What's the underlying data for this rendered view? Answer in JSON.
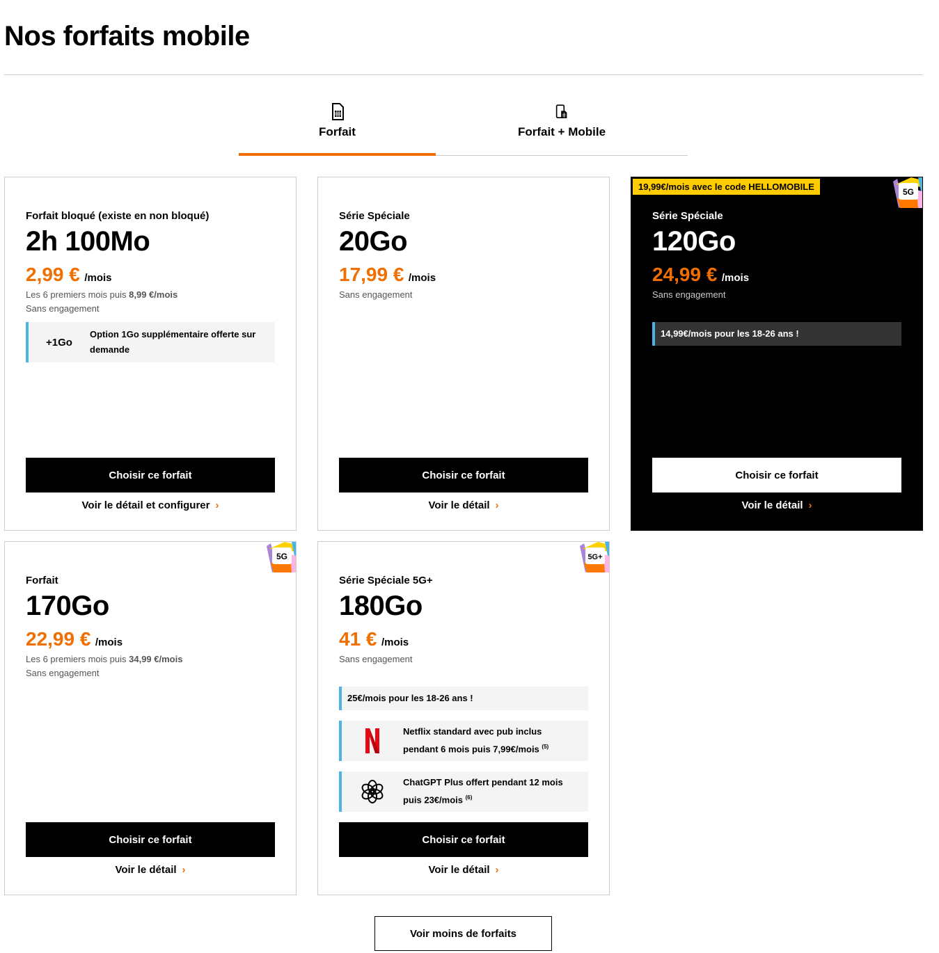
{
  "page": {
    "title": "Nos forfaits mobile"
  },
  "tabs": [
    {
      "label": "Forfait",
      "icon": "sim-card-icon",
      "active": true
    },
    {
      "label": "Forfait + Mobile",
      "icon": "phone-sim-icon",
      "active": false
    }
  ],
  "colors": {
    "accent": "#f16e00",
    "promo_border": "#4bb4e6",
    "banner": "#ffcc00"
  },
  "cards": [
    {
      "category": "Forfait bloqué (existe en non bloqué)",
      "name": "2h 100Mo",
      "price": "2,99 €",
      "per": "/mois",
      "subnote_prefix": "Les 6 premiers mois puis ",
      "subnote_value": "8,99 €/mois",
      "engagement": "Sans engagement",
      "promo_lead": "+1Go",
      "promo_text": "Option 1Go supplémentaire offerte sur demande",
      "cta": "Choisir ce forfait",
      "detail": "Voir le détail et configurer"
    },
    {
      "category": "Série Spéciale",
      "name": "20Go",
      "price": "17,99 €",
      "per": "/mois",
      "engagement": "Sans engagement",
      "cta": "Choisir ce forfait",
      "detail": "Voir le détail"
    },
    {
      "banner": "19,99€/mois avec le code HELLOMOBILE",
      "badge": "5G",
      "category": "Série Spéciale",
      "name": "120Go",
      "price": "24,99 €",
      "per": "/mois",
      "engagement": "Sans engagement",
      "promo_text": "14,99€/mois pour les 18-26 ans !",
      "cta": "Choisir ce forfait",
      "detail": "Voir le détail"
    },
    {
      "badge": "5G",
      "category": "Forfait",
      "name": "170Go",
      "price": "22,99 €",
      "per": "/mois",
      "subnote_prefix": "Les 6 premiers mois puis ",
      "subnote_value": "34,99 €/mois",
      "engagement": "Sans engagement",
      "cta": "Choisir ce forfait",
      "detail": "Voir le détail"
    },
    {
      "badge": "5G+",
      "category": "Série Spéciale 5G+",
      "name": "180Go",
      "price": "41 €",
      "per": "/mois",
      "engagement": "Sans engagement",
      "promo_text": "25€/mois pour les 18-26 ans !",
      "netflix_text": "Netflix standard avec pub inclus pendant 6 mois puis 7,99€/mois",
      "netflix_note": "(5)",
      "chatgpt_text": "ChatGPT Plus offert pendant 12 mois puis 23€/mois",
      "chatgpt_note": "(6)",
      "cta": "Choisir ce forfait",
      "detail": "Voir le détail"
    }
  ],
  "detail_chevron": "›",
  "more_button": "Voir moins de forfaits"
}
